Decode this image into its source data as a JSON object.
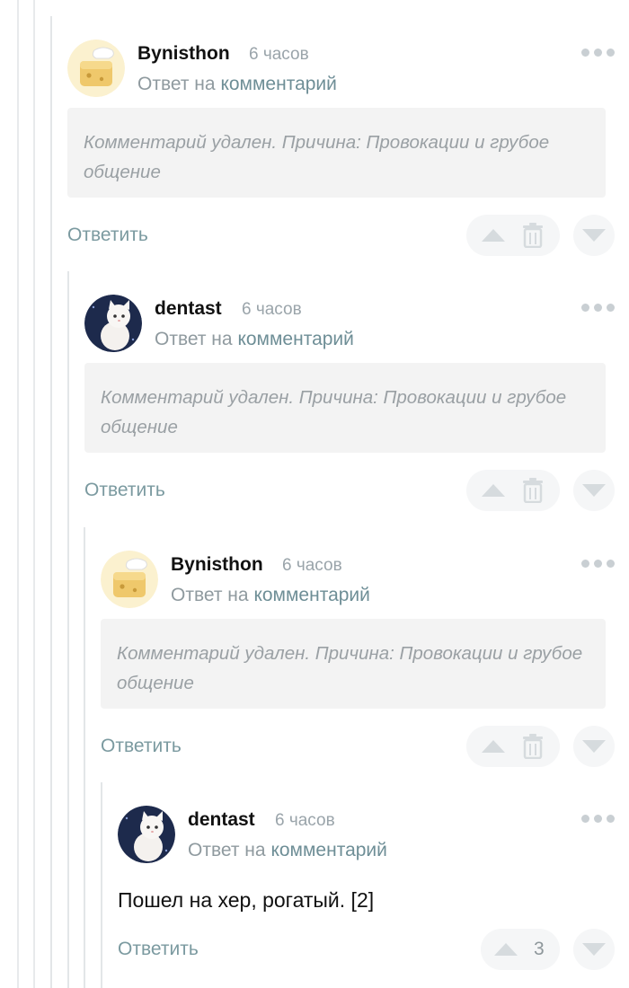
{
  "comments": [
    {
      "author": "Bynisthon",
      "time": "6 часов",
      "reply_prefix": "Ответ на",
      "reply_link": "комментарий",
      "deleted_text": "Комментарий удален. Причина: Провокации и грубое общение",
      "reply_label": "Ответить",
      "avatar": "cheese-character-avatar"
    },
    {
      "author": "dentast",
      "time": "6 часов",
      "reply_prefix": "Ответ на",
      "reply_link": "комментарий",
      "deleted_text": "Комментарий удален. Причина: Провокации и грубое общение",
      "reply_label": "Ответить",
      "avatar": "white-cat-avatar"
    },
    {
      "author": "Bynisthon",
      "time": "6 часов",
      "reply_prefix": "Ответ на",
      "reply_link": "комментарий",
      "deleted_text": "Комментарий удален. Причина: Провокации и грубое общение",
      "reply_label": "Ответить",
      "avatar": "cheese-character-avatar"
    },
    {
      "author": "dentast",
      "time": "6 часов",
      "reply_prefix": "Ответ на",
      "reply_link": "комментарий",
      "text": "Пошел на хер, рогатый. [2]",
      "reply_label": "Ответить",
      "rating": "3",
      "avatar": "white-cat-avatar"
    }
  ],
  "icons": {
    "more": "more-dots-icon",
    "upvote": "upvote-icon",
    "downvote": "downvote-icon",
    "delete": "trash-icon"
  },
  "colors": {
    "link": "#6e8e96",
    "muted": "#9aa4aa",
    "deleted_bg": "#f3f3f3",
    "vote_bg": "#f5f6f7",
    "thread_line": "#e3e6e8"
  }
}
